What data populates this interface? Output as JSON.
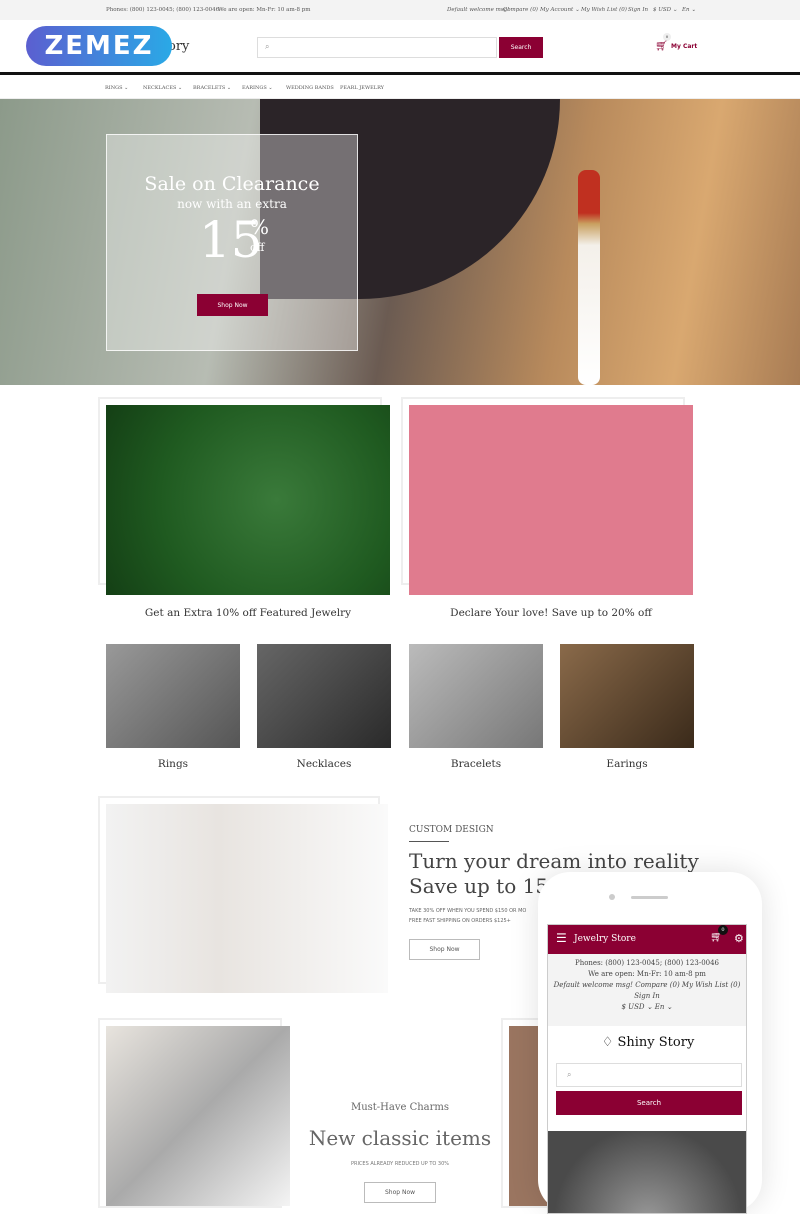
{
  "topbar": {
    "phones": "Phones: (800) 123-0045; (800) 123-0046",
    "hours": "We are open: Mn-Fr: 10 am-8 pm",
    "welcome": "Default welcome msg!",
    "compare": "Compare (0)",
    "account": "My Account ⌄",
    "wishlist": "My Wish List (0)",
    "signin": "Sign In",
    "currency": "$ USD ⌄",
    "lang": "En ⌄"
  },
  "header": {
    "logo": "ZEMEZ",
    "logo_tail": "ory",
    "search_button": "Search",
    "cart_count": "0",
    "cart_label": "My Cart"
  },
  "nav": [
    "RINGS ⌄",
    "NECKLACES ⌄",
    "BRACELETS ⌄",
    "EARINGS ⌄",
    "WEDDING BANDS",
    "PEARL JEWELRY"
  ],
  "hero": {
    "title": "Sale on Clearance",
    "subtitle": "now with an extra",
    "number": "15",
    "percent": "%",
    "off": "off",
    "button": "Shop Now"
  },
  "banners": [
    "Get an Extra 10% off Featured Jewelry",
    "Declare Your love! Save up to 20% off"
  ],
  "categories": [
    "Rings",
    "Necklaces",
    "Bracelets",
    "Earings"
  ],
  "custom": {
    "eyebrow": "CUSTOM DESIGN",
    "title1": "Turn your dream into reality",
    "title2": "Save up to 15%",
    "line1": "TAKE 30% OFF WHEN YOU SPEND $150 OR MO",
    "line2": "FREE FAST SHIPPING ON ORDERS $125+",
    "button": "Shop Now"
  },
  "charms": {
    "eyebrow": "Must-Have Charms",
    "title": "New classic items",
    "sub": "PRICES ALREADY REDUCED UP TO 30%",
    "button": "Shop Now"
  },
  "mobile": {
    "store": "Jewelry Store",
    "cart_count": "0",
    "phones": "Phones: (800) 123-0045; (800) 123-0046",
    "hours": "We are open: Mn-Fr: 10 am-8 pm",
    "links": "Default welcome msg!  Compare (0)   My Wish List (0)   Sign In",
    "currency": "$ USD ⌄   En ⌄",
    "brand": "Shiny Story",
    "search_button": "Search"
  },
  "colors": {
    "accent": "#8b0033"
  }
}
